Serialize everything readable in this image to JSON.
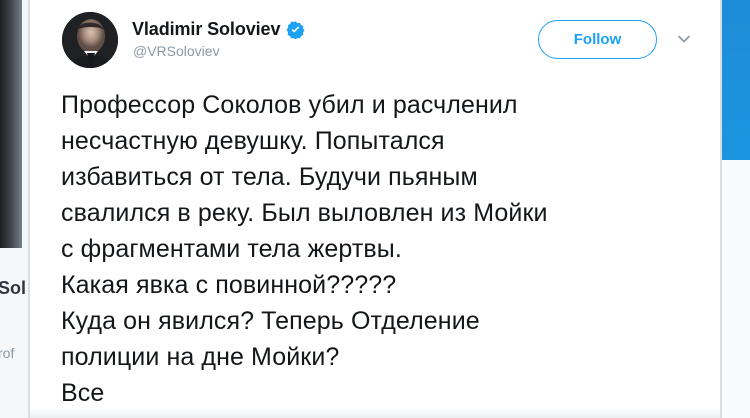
{
  "background": {
    "left_text_1": "Sol",
    "left_text_2": "rof"
  },
  "tweet": {
    "author": {
      "display_name": "Vladimir Soloviev",
      "handle": "@VRSoloviev",
      "avatar_icon": "avatar",
      "verified_icon": "verified-badge-icon"
    },
    "actions": {
      "follow_label": "Follow",
      "more_icon": "chevron-down-icon"
    },
    "body_lines": [
      "Профессор Соколов убил и расчленил",
      "несчастную девушку. Попытался",
      "избавиться от тела. Будучи пьяным",
      "свалился в реку. Был выловлен из Мойки",
      "с фрагментами тела жертвы.",
      "Какая явка с повинной?????",
      "Куда он явился? Теперь Отделение",
      "полиции на дне Мойки?",
      "Все"
    ]
  },
  "colors": {
    "primary_blue": "#1da1f2",
    "text_dark": "#14171a",
    "text_gray": "#8899a6",
    "background": "#ffffff"
  }
}
